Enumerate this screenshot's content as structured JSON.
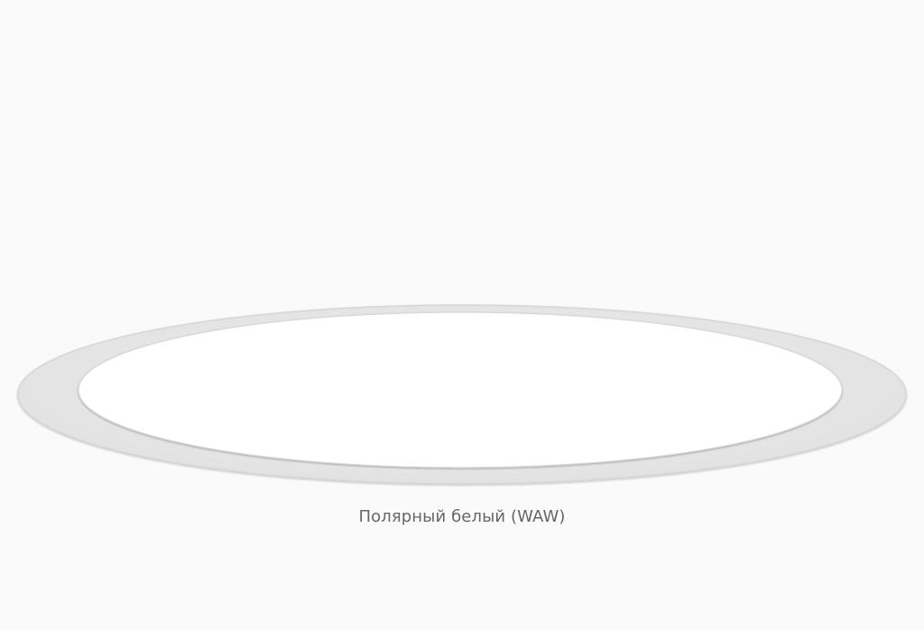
{
  "swatch": {
    "name": "Полярный белый (WAW)",
    "color": "#ffffff",
    "rim_color": "#e8e8e8"
  }
}
